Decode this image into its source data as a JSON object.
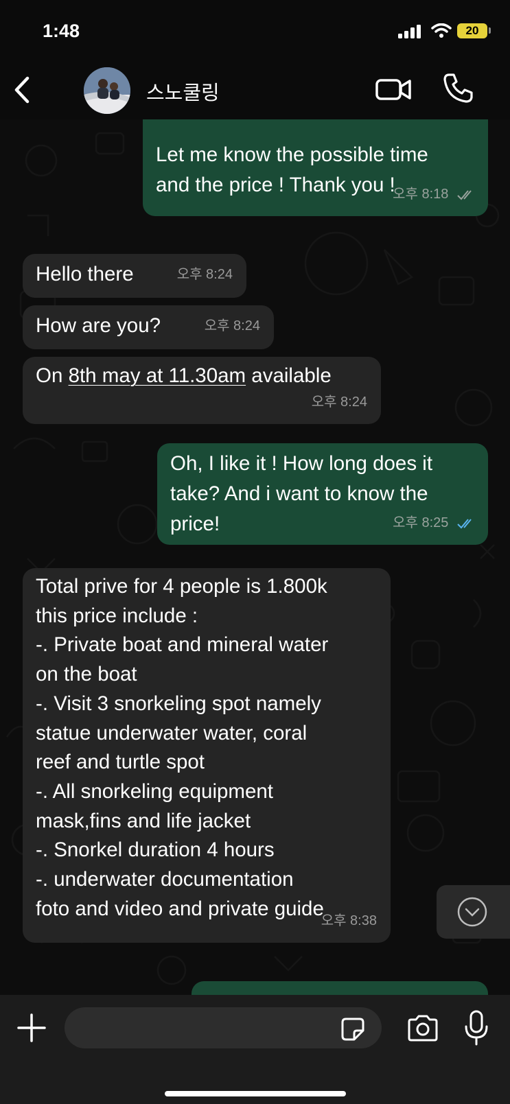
{
  "status_bar": {
    "time": "1:48",
    "battery": "20"
  },
  "header": {
    "contact_name": "스노쿨링"
  },
  "messages": [
    {
      "dir": "out",
      "text": "Let me know the possible time\nand the price ! Thank you !",
      "time": "오후 8:18"
    },
    {
      "dir": "in",
      "text": "Hello there",
      "time": "오후 8:24"
    },
    {
      "dir": "in",
      "text": "How are you?",
      "time": "오후 8:24"
    },
    {
      "dir": "in",
      "pre": "On ",
      "link": "8th may at 11.30am",
      "post": " available",
      "time": "오후 8:24"
    },
    {
      "dir": "out",
      "text": "Oh, I like it ! How long does it\ntake? And i want to know the\nprice!",
      "time": "오후 8:25"
    },
    {
      "dir": "in",
      "text": "Total prive for 4 people is 1.800k\nthis price include :\n-. Private boat and mineral water\non the boat\n-. Visit 3 snorkeling spot namely\nstatue underwater water, coral\nreef and turtle spot\n-. All snorkeling equipment\nmask,fins and life jacket\n-. Snorkel duration 4 hours\n-. underwater documentation\nfoto and video and private guide",
      "time": "오후 8:38"
    }
  ],
  "input": {
    "value": "",
    "placeholder": ""
  },
  "colors": {
    "incoming_bubble": "#252525",
    "outgoing_bubble": "#1a4b36",
    "read_tick_blue": "#5ab4f0",
    "delivered_tick": "#9aa39e",
    "battery": "#e6d23a"
  },
  "icons": [
    "back-icon",
    "video-call-icon",
    "phone-icon",
    "scroll-down-icon",
    "plus-icon",
    "sticker-icon",
    "camera-icon",
    "mic-icon",
    "double-check-icon"
  ]
}
